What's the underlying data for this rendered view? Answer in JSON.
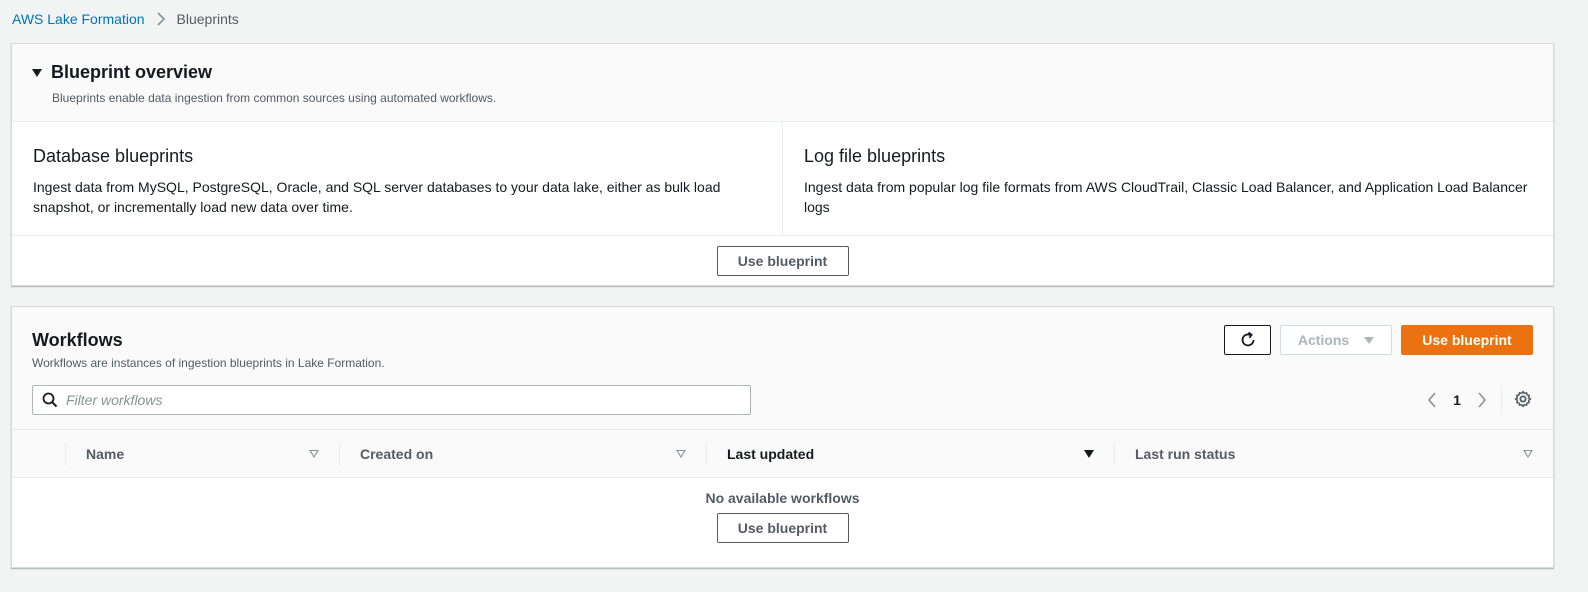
{
  "breadcrumb": {
    "root": "AWS Lake Formation",
    "current": "Blueprints"
  },
  "overview": {
    "title": "Blueprint overview",
    "description": "Blueprints enable data ingestion from common sources using automated workflows.",
    "columns": [
      {
        "title": "Database blueprints",
        "text": "Ingest data from MySQL, PostgreSQL, Oracle, and SQL server databases to your data lake, either as bulk load snapshot, or incrementally load new data over time."
      },
      {
        "title": "Log file blueprints",
        "text": "Ingest data from popular log file formats from AWS CloudTrail, Classic Load Balancer, and Application Load Balancer logs"
      }
    ],
    "button": "Use blueprint"
  },
  "workflows": {
    "title": "Workflows",
    "description": "Workflows are instances of ingestion blueprints in Lake Formation.",
    "refresh_icon": "refresh-icon",
    "actions_label": "Actions",
    "primary_button": "Use blueprint",
    "filter_placeholder": "Filter workflows",
    "page": "1",
    "columns": [
      "Name",
      "Created on",
      "Last updated",
      "Last run status"
    ],
    "sorted_column": "Last updated",
    "empty_text": "No available workflows",
    "empty_button": "Use blueprint"
  },
  "colors": {
    "accent": "#ec7211",
    "link": "#0073bb",
    "background": "#f2f3f3"
  }
}
